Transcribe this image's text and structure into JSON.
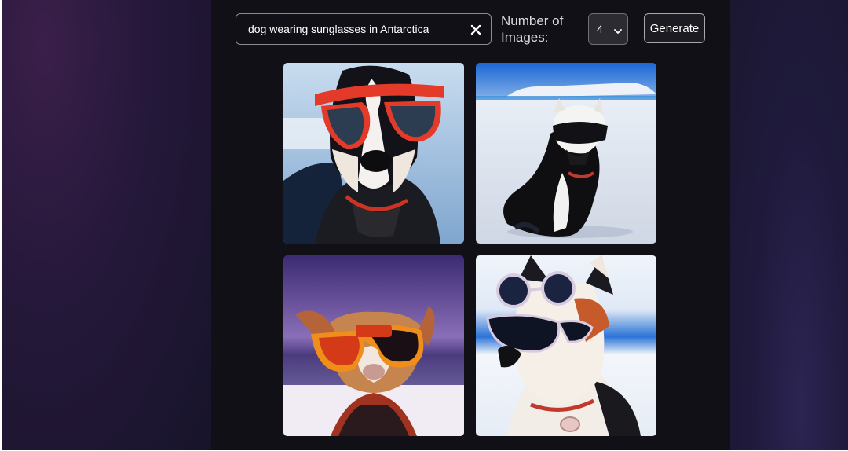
{
  "search": {
    "value": "dog wearing sunglasses in Antarctica",
    "clear_icon": "close-icon"
  },
  "controls": {
    "count_label": "Number of Images:",
    "count_value": "4",
    "generate_label": "Generate",
    "chevron_icon": "chevron-down-icon"
  },
  "gallery": {
    "images": [
      {
        "subject": "husky with red sunglasses"
      },
      {
        "subject": "dog with white goggles on ice field"
      },
      {
        "subject": "dog with orange sunglasses at sunset"
      },
      {
        "subject": "husky with round dark sunglasses"
      }
    ]
  },
  "colors": {
    "panel": "#121017",
    "accent_border": "#8b8b94"
  }
}
